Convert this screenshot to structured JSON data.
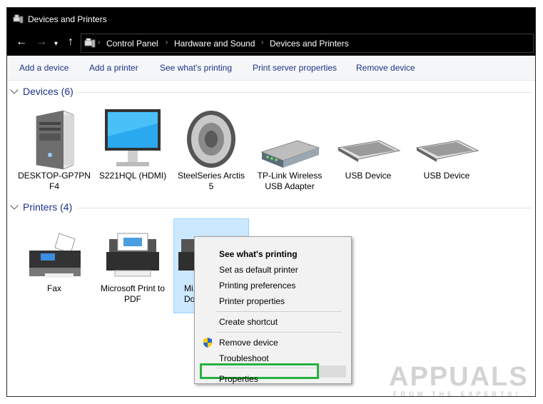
{
  "window": {
    "title": "Devices and Printers"
  },
  "address": {
    "crumbs": [
      "Control Panel",
      "Hardware and Sound",
      "Devices and Printers"
    ]
  },
  "toolbar": {
    "commands": [
      "Add a device",
      "Add a printer",
      "See what's printing",
      "Print server properties",
      "Remove device"
    ]
  },
  "devices_group": {
    "label": "Devices (6)"
  },
  "devices": [
    {
      "label": "DESKTOP-GP7PN F4",
      "icon": "computer-icon"
    },
    {
      "label": "S221HQL (HDMI)",
      "icon": "monitor-icon"
    },
    {
      "label": "SteelSeries Arctis 5",
      "icon": "speaker-icon"
    },
    {
      "label": "TP-Link Wireless USB Adapter",
      "icon": "usb-adapter-icon"
    },
    {
      "label": "USB Device",
      "icon": "keyboard-icon"
    },
    {
      "label": "USB Device",
      "icon": "keyboard-icon"
    }
  ],
  "printers_group": {
    "label": "Printers (4)"
  },
  "printers": [
    {
      "label": "Fax",
      "icon": "fax-icon"
    },
    {
      "label": "Microsoft Print to PDF",
      "icon": "printer-icon"
    },
    {
      "label": "Mi... Doc...",
      "icon": "printer-icon",
      "selected": true
    }
  ],
  "context_menu": {
    "items": [
      "See what's printing",
      "Set as default printer",
      "Printing preferences",
      "Printer properties",
      "Create shortcut",
      "Remove device",
      "Troubleshoot",
      "Properties"
    ],
    "bold_item": "See what's printing",
    "highlighted_item": "Properties",
    "highlight_color": "#27b040"
  },
  "watermark": {
    "brand": "APPUALS",
    "tagline": "FROM THE EXPERTS!"
  }
}
